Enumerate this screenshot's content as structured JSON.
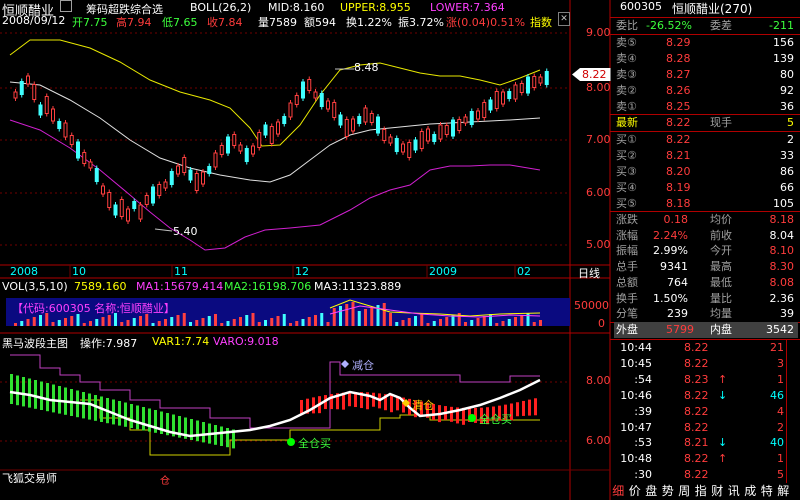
{
  "stock_name": "恒顺醋业",
  "top_title": "筹码超跌综合选",
  "header": {
    "date": "2008/09/12",
    "open": "开7.75",
    "high": "高7.94",
    "low": "低7.65",
    "close": "收7.84",
    "volume": "量7589",
    "amount": "额594",
    "turnover": "换1.22%",
    "amplitude": "振3.72%",
    "change": "涨(0.04)0.51%",
    "index_btn": "指数",
    "boll": "BOLL(26,2)",
    "mid": "MID:8.160",
    "upper": "UPPER:8.955",
    "lower": "LOWER:7.364"
  },
  "price_axis": [
    "9.00",
    "8.00",
    "7.00",
    "6.00",
    "5.00"
  ],
  "current_price_tag": "8.22",
  "chart_labels": {
    "high_mark": "8.48",
    "low_mark": "5.40"
  },
  "date_axis": [
    "2008",
    "10",
    "11",
    "12",
    "2009",
    "02"
  ],
  "period_label": "日线",
  "vol_header": {
    "vol": "VOL(3,5,10)",
    "v": "7589.160",
    "ma1": "MA1:15679.414",
    "ma2": "MA2:16198.706",
    "ma3": "MA3:11323.889"
  },
  "vol_info_box": "【代码:600305 名称:恒顺醋业】",
  "vol_axis": [
    "50000",
    "0"
  ],
  "ind_header": {
    "name": "黑马波段主图",
    "op": "操作:7.987",
    "var1": "VAR1:7.74",
    "var0": "VARO:9.018"
  },
  "ind_axis": [
    "8.00",
    "6.00"
  ],
  "ind_labels": {
    "reduce": "减仓",
    "clear": "清仓",
    "full_buy_1": "全仓买",
    "full_buy_2": "全仓买",
    "bottom_mark": "仓"
  },
  "trader_label": "飞狐交易师",
  "right_panel": {
    "code": "600305",
    "name": "恒顺醋业(270)",
    "weibi_label": "委比",
    "weibi_val": "-26.52%",
    "weicha_label": "委差",
    "weicha_val": "-211",
    "sells": [
      {
        "label": "卖⑤",
        "price": "8.29",
        "vol": "156"
      },
      {
        "label": "卖④",
        "price": "8.28",
        "vol": "139"
      },
      {
        "label": "卖③",
        "price": "8.27",
        "vol": "80"
      },
      {
        "label": "卖②",
        "price": "8.26",
        "vol": "92"
      },
      {
        "label": "卖①",
        "price": "8.25",
        "vol": "36"
      }
    ],
    "latest": {
      "label": "最新",
      "price": "8.22",
      "label2": "现手",
      "vol": "5"
    },
    "buys": [
      {
        "label": "买①",
        "price": "8.22",
        "vol": "2"
      },
      {
        "label": "买②",
        "price": "8.21",
        "vol": "33"
      },
      {
        "label": "买③",
        "price": "8.20",
        "vol": "86"
      },
      {
        "label": "买④",
        "price": "8.19",
        "vol": "66"
      },
      {
        "label": "买⑤",
        "price": "8.18",
        "vol": "105"
      }
    ],
    "stats": [
      {
        "l1": "涨跌",
        "v1": "0.18",
        "l2": "均价",
        "v2": "8.18"
      },
      {
        "l1": "涨幅",
        "v1": "2.24%",
        "l2": "前收",
        "v2": "8.04"
      },
      {
        "l1": "振幅",
        "v1": "2.99%",
        "l2": "今开",
        "v2": "8.10"
      },
      {
        "l1": "总手",
        "v1": "9341",
        "l2": "最高",
        "v2": "8.30"
      },
      {
        "l1": "总额",
        "v1": "764",
        "l2": "最低",
        "v2": "8.08"
      },
      {
        "l1": "换手",
        "v1": "1.50%",
        "l2": "量比",
        "v2": "2.36"
      },
      {
        "l1": "分笔",
        "v1": "239",
        "l2": "均量",
        "v2": "39"
      }
    ],
    "outer_label": "外盘",
    "outer_val": "5799",
    "inner_label": "内盘",
    "inner_val": "3542",
    "ticks": [
      {
        "time": "10:44",
        "price": "8.22",
        "arrow": "",
        "vol": "21"
      },
      {
        "time": "10:45",
        "price": "8.22",
        "arrow": "",
        "vol": "3"
      },
      {
        "time": ":54",
        "price": "8.23",
        "arrow": "↑",
        "vol": "1"
      },
      {
        "time": "10:46",
        "price": "8.22",
        "arrow": "↓",
        "vol": "46"
      },
      {
        "time": ":39",
        "price": "8.22",
        "arrow": "",
        "vol": "4"
      },
      {
        "time": "10:47",
        "price": "8.22",
        "arrow": "",
        "vol": "2"
      },
      {
        "time": ":53",
        "price": "8.21",
        "arrow": "↓",
        "vol": "40"
      },
      {
        "time": "10:48",
        "price": "8.22",
        "arrow": "↑",
        "vol": "1"
      },
      {
        "time": ":30",
        "price": "8.22",
        "arrow": "",
        "vol": "5"
      }
    ],
    "bottom_tabs": [
      "细",
      "价",
      "盘",
      "势",
      "周",
      "指",
      "财",
      "讯",
      "成",
      "特",
      "解"
    ]
  }
}
